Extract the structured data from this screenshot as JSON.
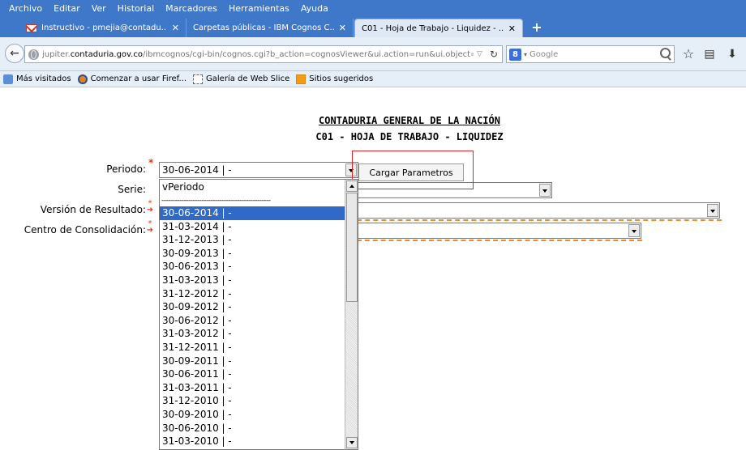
{
  "menu": {
    "items": [
      "Archivo",
      "Editar",
      "Ver",
      "Historial",
      "Marcadores",
      "Herramientas",
      "Ayuda"
    ]
  },
  "tabs": [
    {
      "label": "Instructivo - pmejia@contadu...",
      "icon": "gmail-icon",
      "active": false
    },
    {
      "label": "Carpetas públicas - IBM Cognos C...",
      "active": false
    },
    {
      "label": "C01 - Hoja de Trabajo - Liquidez - ...",
      "active": true
    }
  ],
  "tabs_close_glyph": "✕",
  "new_tab_glyph": "+",
  "navbar": {
    "url_prefix": "jupiter.",
    "url_domain": "contaduria.gov.co",
    "url_path": "/ibmcognos/cgi-bin/cognos.cgi?b_action=cognosViewer&ui.action=run&ui.object=%",
    "search_engine_letter": "8",
    "search_placeholder": "Google"
  },
  "bookmarks": [
    {
      "label": "Más visitados",
      "icon": "most-visited-icon"
    },
    {
      "label": "Comenzar a usar Firef...",
      "icon": "firefox-icon"
    },
    {
      "label": "Galería de Web Slice",
      "icon": "webslice-icon"
    },
    {
      "label": "Sitios sugeridos",
      "icon": "suggested-icon"
    }
  ],
  "page": {
    "title": "CONTADURIA GENERAL DE LA NACIÓN",
    "subtitle": "C01 - HOJA DE TRABAJO - LIQUIDEZ"
  },
  "form": {
    "periodo_label": "Periodo:",
    "serie_label": "Serie:",
    "version_label": "Versión de Resultado:",
    "centro_label": "Centro de Consolidación:",
    "periodo_value": "30-06-2014 | -",
    "cargar_label": "Cargar Parametros",
    "required_star": "*"
  },
  "periodo_list": {
    "header": "vPeriodo",
    "separator": "-------------------------------------------------",
    "options": [
      "30-06-2014 | -",
      "31-03-2014 | -",
      "31-12-2013 | -",
      "30-09-2013 | -",
      "30-06-2013 | -",
      "31-03-2013 | -",
      "31-12-2012 | -",
      "30-09-2012 | -",
      "30-06-2012 | -",
      "31-03-2012 | -",
      "31-12-2011 | -",
      "30-09-2011 | -",
      "30-06-2011 | -",
      "31-03-2011 | -",
      "31-12-2010 | -",
      "30-09-2010 | -",
      "30-06-2010 | -",
      "31-03-2010 | -"
    ],
    "selected_index": 0
  }
}
